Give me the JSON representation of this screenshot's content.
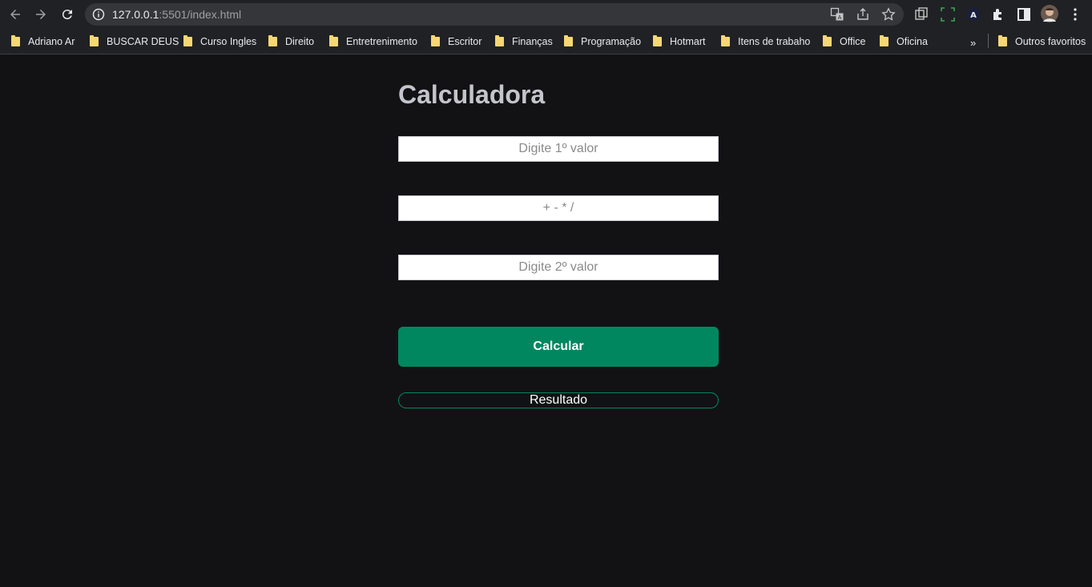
{
  "browser": {
    "url_host": "127.0.0.1",
    "url_path": ":5501/index.html",
    "bookmarks": [
      {
        "label": "Adriano Ar"
      },
      {
        "label": "BUSCAR DEUS"
      },
      {
        "label": "Curso Ingles"
      },
      {
        "label": "Direito"
      },
      {
        "label": "Entretrenimento"
      },
      {
        "label": "Escritor"
      },
      {
        "label": "Finanças"
      },
      {
        "label": "Programação"
      },
      {
        "label": "Hotmart"
      },
      {
        "label": "Itens de trabaho"
      },
      {
        "label": "Office"
      },
      {
        "label": "Oficina"
      }
    ],
    "more_bookmarks": "»",
    "other_favorites": "Outros favoritos",
    "icons": [
      "back-icon",
      "forward-icon",
      "reload-icon",
      "info-icon",
      "translate-icon",
      "share-icon",
      "star-icon",
      "tab-search-icon",
      "screenshot-icon",
      "extension-a-icon",
      "puzzle-icon",
      "sidebar-icon",
      "avatar",
      "menu-icon"
    ]
  },
  "page": {
    "title": "Calculadora",
    "first_value_placeholder": "Digite 1º valor",
    "operator_placeholder": "+ - * /",
    "second_value_placeholder": "Digite 2º valor",
    "calculate_label": "Calcular",
    "result_label": "Resultado"
  },
  "colors": {
    "background": "#121214",
    "accent": "#00875f",
    "title": "#c4c4cc"
  }
}
